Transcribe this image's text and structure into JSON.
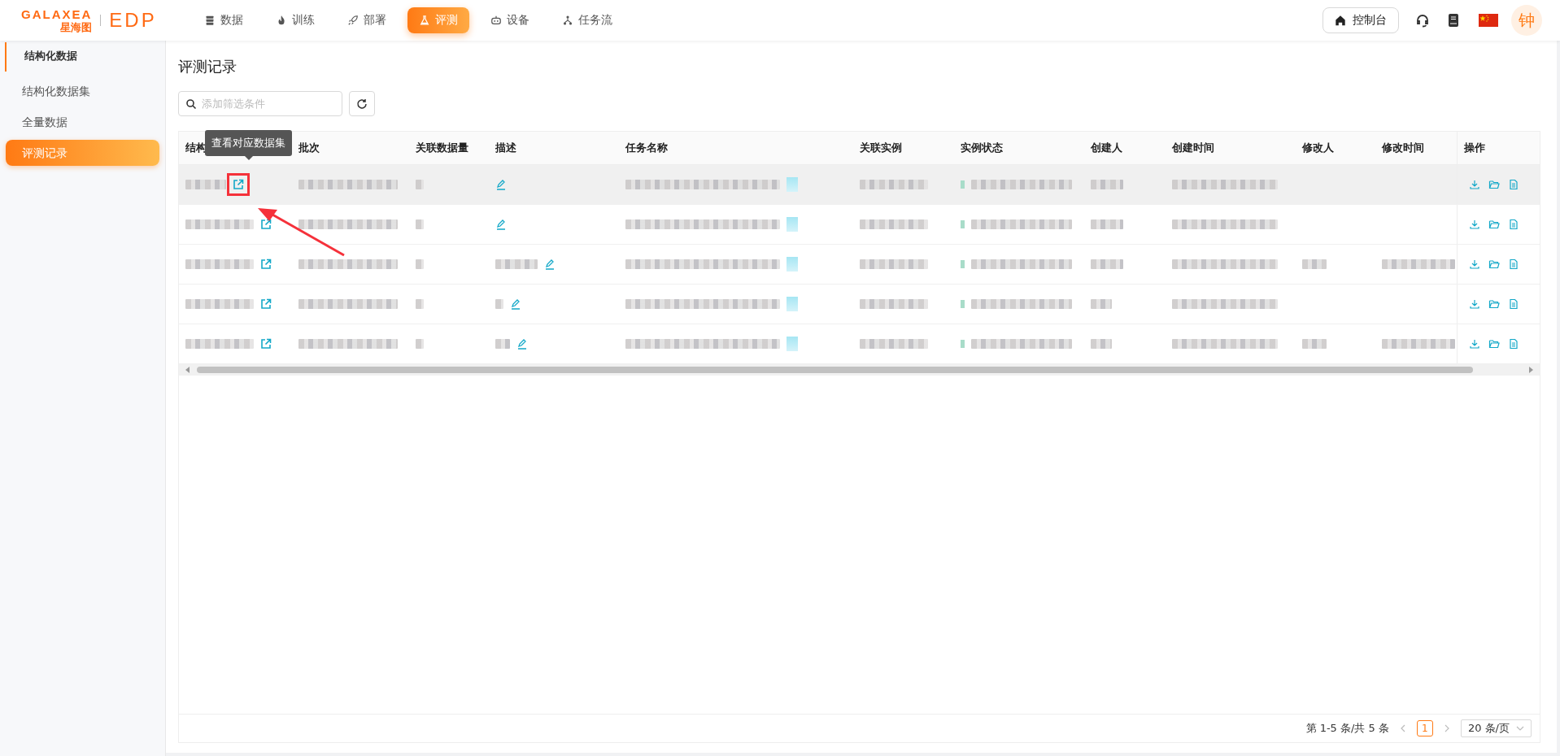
{
  "logo": {
    "brand": "GALAXEA",
    "sub": "星海图",
    "product": "EDP"
  },
  "nav": [
    {
      "label": "数据",
      "selected": false
    },
    {
      "label": "训练",
      "selected": false
    },
    {
      "label": "部署",
      "selected": false
    },
    {
      "label": "评测",
      "selected": true
    },
    {
      "label": "设备",
      "selected": false
    },
    {
      "label": "任务流",
      "selected": false
    }
  ],
  "header_actions": {
    "console": "控制台",
    "avatar": "钟"
  },
  "sidebar": {
    "group": "结构化数据",
    "items": [
      {
        "label": "结构化数据集",
        "selected": false
      },
      {
        "label": "全量数据",
        "selected": false
      },
      {
        "label": "评测记录",
        "selected": true
      }
    ]
  },
  "page_title": "评测记录",
  "search": {
    "placeholder": "添加筛选条件"
  },
  "table": {
    "columns": [
      "结构",
      "批次",
      "关联数据量",
      "描述",
      "任务名称",
      "关联实例",
      "实例状态",
      "创建人",
      "创建时间",
      "修改人",
      "修改时间",
      "操作"
    ],
    "tooltip": "查看对应数据集",
    "rows": [
      {
        "hovered": true,
        "annotated": true,
        "has_description": false,
        "modified": false
      },
      {
        "hovered": false,
        "annotated": false,
        "has_description": false,
        "modified": false
      },
      {
        "hovered": false,
        "annotated": false,
        "has_description": true,
        "modified": true
      },
      {
        "hovered": false,
        "annotated": false,
        "has_description": true,
        "modified": false
      },
      {
        "hovered": false,
        "annotated": false,
        "has_description": true,
        "modified": true
      }
    ]
  },
  "pagination": {
    "summary": "第 1-5 条/共 5 条",
    "pages": [
      {
        "label": "1",
        "selected": true
      }
    ],
    "page_size": "20 条/页"
  }
}
